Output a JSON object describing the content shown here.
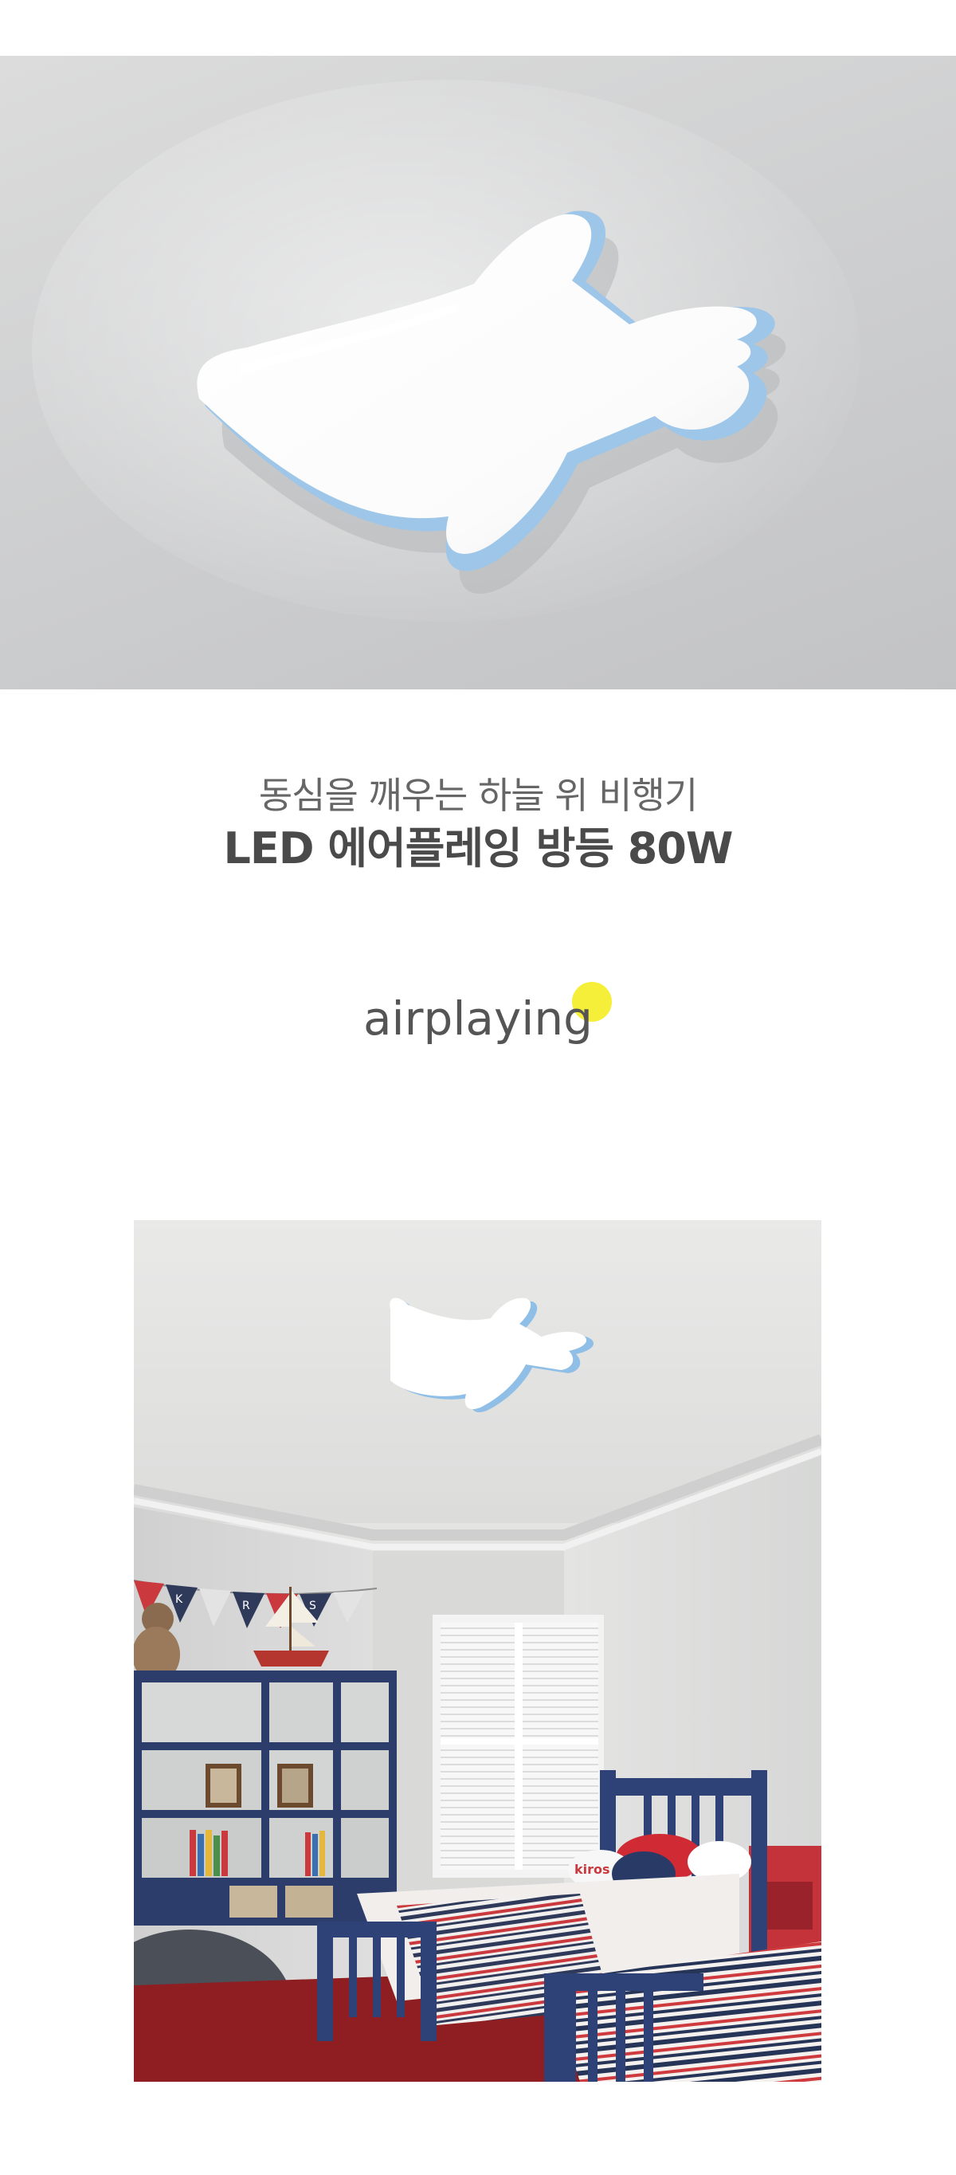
{
  "hero_image": {
    "alt": "airplane-ceiling-lamp-closeup",
    "lamp_frame_color": "#9dc6e9",
    "lamp_face_color": "#ffffff"
  },
  "headline": {
    "tagline": "동심을 깨우는 하늘 위 비행기",
    "product_title": "LED 에어플레잉 방등 80W"
  },
  "brand": {
    "wordmark": "airplaying",
    "accent_color": "#f5ef3a"
  },
  "room_image": {
    "alt": "kids-bedroom-with-airplane-lamp",
    "pillow_text": "kiros",
    "bunting_letters": [
      "K",
      "R",
      "S"
    ]
  }
}
